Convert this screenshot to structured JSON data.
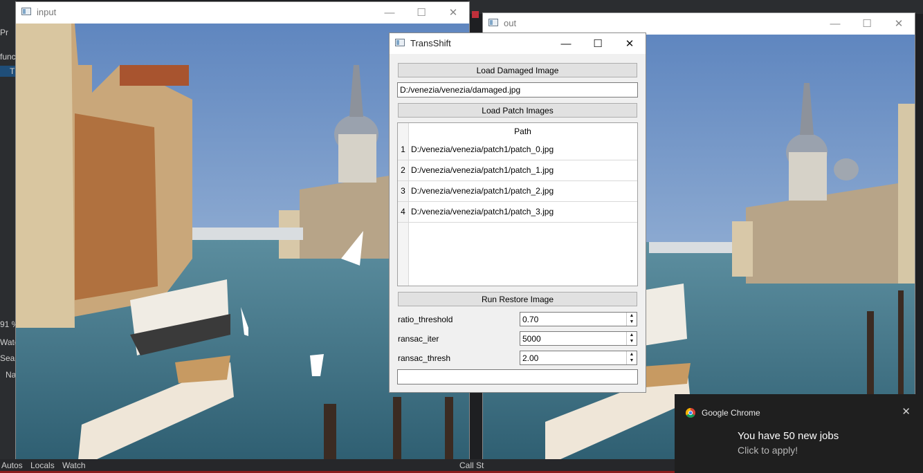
{
  "ide": {
    "left_fragments": [
      "Pr",
      "func",
      "T",
      "91 %",
      "Watc",
      "Sear",
      "Na"
    ],
    "bottom_fragments": [
      "Autos",
      "Locals",
      "Watch",
      "Call St"
    ]
  },
  "input_window": {
    "title": "input"
  },
  "out_window": {
    "title": "out"
  },
  "window_controls": {
    "minimize": "—",
    "maximize": "☐",
    "close": "✕"
  },
  "dialog": {
    "title": "TransShift",
    "load_damaged_label": "Load Damaged Image",
    "damaged_path": "D:/venezia/venezia/damaged.jpg",
    "load_patch_label": "Load Patch Images",
    "table": {
      "header": "Path",
      "rows": [
        {
          "num": "1",
          "path": "D:/venezia/venezia/patch1/patch_0.jpg"
        },
        {
          "num": "2",
          "path": "D:/venezia/venezia/patch1/patch_1.jpg"
        },
        {
          "num": "3",
          "path": "D:/venezia/venezia/patch1/patch_2.jpg"
        },
        {
          "num": "4",
          "path": "D:/venezia/venezia/patch1/patch_3.jpg"
        }
      ]
    },
    "run_label": "Run Restore Image",
    "params": {
      "ratio_label": "ratio_threshold",
      "ratio_value": "0.70",
      "iter_label": "ransac_iter",
      "iter_value": "5000",
      "thresh_label": "ransac_thresh",
      "thresh_value": "2.00"
    },
    "status_text": ""
  },
  "notification": {
    "app": "Google Chrome",
    "headline": "You have 50 new jobs",
    "subtext": "Click to apply!"
  }
}
